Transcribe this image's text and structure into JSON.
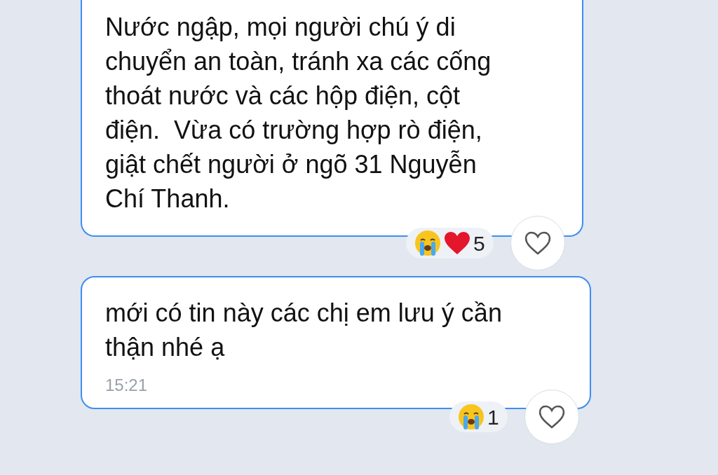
{
  "messages": [
    {
      "lines": [
        "Nước ngập, mọi người chú ý di",
        "chuyển an toàn, tránh xa các cống",
        "thoát nước và các hộp điện, cột",
        "điện.  Vừa có trường hợp rò điện,",
        "giật chết người ở ngõ 31 Nguyễn",
        "Chí Thanh."
      ],
      "cut_top": true,
      "reactions": [
        {
          "kind": "crying"
        },
        {
          "kind": "heart"
        }
      ],
      "reaction_count": "5"
    },
    {
      "lines": [
        "mới có tin này các chị em lưu ý cần",
        "thận nhé ạ"
      ],
      "cut_top": false,
      "time": "15:21",
      "reactions": [
        {
          "kind": "crying"
        }
      ],
      "reaction_count": "1"
    }
  ]
}
